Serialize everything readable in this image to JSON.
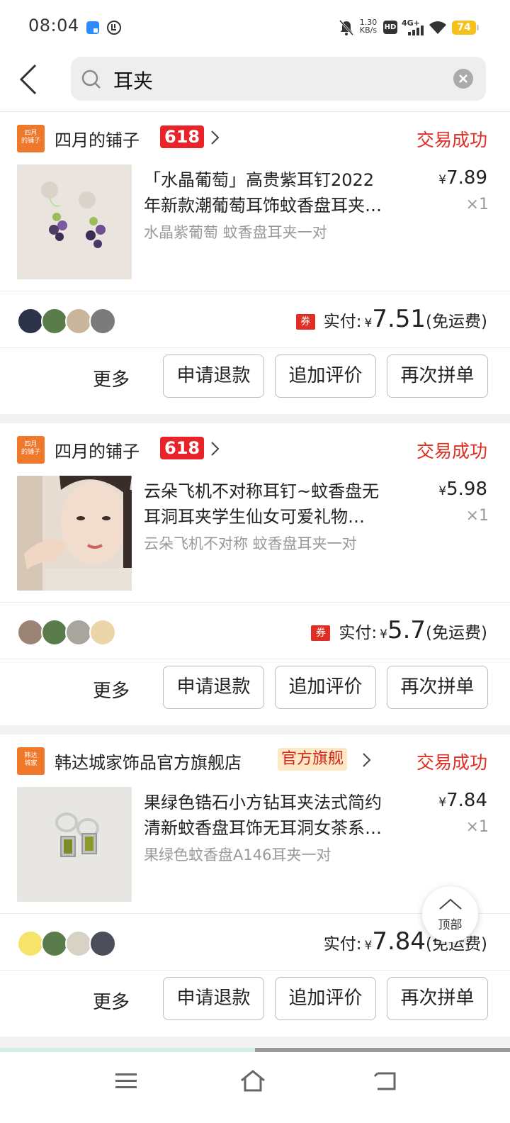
{
  "status_bar": {
    "time": "08:04",
    "net_speed_value": "1.30",
    "net_speed_unit": "KB/s",
    "hd_label": "HD",
    "network": "4G+",
    "battery": "74"
  },
  "search": {
    "query": "耳夹"
  },
  "orders": [
    {
      "shop_logo_text": "四月\n的铺子",
      "shop_name": "四月的铺子",
      "shop_tag": "618",
      "status": "交易成功",
      "title_line1": "「水晶葡萄」高贵紫耳钉2022",
      "title_line2": "年新款潮葡萄耳饰蚊香盘耳夹…",
      "sku": "水晶紫葡萄 蚊香盘耳夹一对",
      "price": "7.89",
      "qty": "×1",
      "coupon": "券",
      "paid_label": "实付:",
      "paid_amount": "7.51",
      "shipping": "(免运费)"
    },
    {
      "shop_logo_text": "四月\n的铺子",
      "shop_name": "四月的铺子",
      "shop_tag": "618",
      "status": "交易成功",
      "title_line1": "云朵飞机不对称耳钉~蚊香盘无",
      "title_line2": "耳洞耳夹学生仙女可爱礼物…",
      "sku": "云朵飞机不对称 蚊香盘耳夹一对",
      "price": "5.98",
      "qty": "×1",
      "coupon": "券",
      "paid_label": "实付:",
      "paid_amount": "5.7",
      "shipping": "(免运费)"
    },
    {
      "shop_logo_text": "韩达\n城家",
      "shop_name": "韩达城家饰品官方旗舰店",
      "shop_tag": "官方旗舰",
      "status": "交易成功",
      "title_line1": "果绿色锆石小方钻耳夹法式简约",
      "title_line2": "清新蚊香盘耳饰无耳洞女茶系…",
      "sku": "果绿色蚊香盘A146耳夹一对",
      "price": "7.84",
      "qty": "×1",
      "paid_label": "实付:",
      "paid_amount": "7.84",
      "shipping": "(免运费)"
    }
  ],
  "actions": {
    "more": "更多",
    "refund": "申请退款",
    "add_review": "追加评价",
    "reorder": "再次拼单"
  },
  "currency": "¥",
  "top_button": "顶部",
  "colors": {
    "accent_red": "#e02e24",
    "tag_red": "#e8232a",
    "shop_logo_orange": "#f0782a",
    "official_tag_bg": "#fde7c5"
  }
}
